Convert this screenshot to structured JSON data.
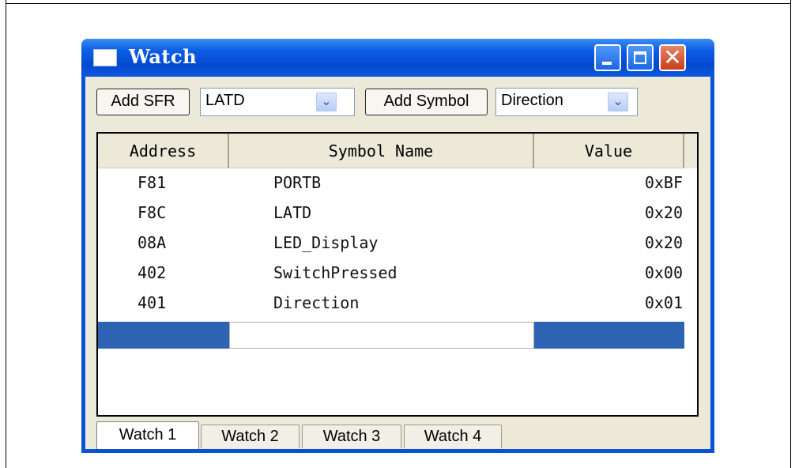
{
  "window": {
    "title": "Watch",
    "controls": {
      "minimize": "minimize-icon",
      "maximize": "maximize-icon",
      "close": "close-icon",
      "close_glyph": "✕"
    }
  },
  "toolbar": {
    "add_sfr_label": "Add SFR",
    "sfr_selected": "LATD",
    "add_symbol_label": "Add Symbol",
    "symbol_selected": "Direction",
    "dropdown_glyph": "⌄"
  },
  "grid": {
    "columns": [
      "Address",
      "Symbol Name",
      "Value"
    ],
    "rows": [
      {
        "address": "F81",
        "symbol": "PORTB",
        "value": "0xBF"
      },
      {
        "address": "F8C",
        "symbol": "LATD",
        "value": "0x20"
      },
      {
        "address": "08A",
        "symbol": "LED_Display",
        "value": "0x20"
      },
      {
        "address": "402",
        "symbol": "SwitchPressed",
        "value": "0x00"
      },
      {
        "address": "401",
        "symbol": "Direction",
        "value": "0x01"
      }
    ]
  },
  "tabs": [
    "Watch 1",
    "Watch 2",
    "Watch 3",
    "Watch 4"
  ],
  "active_tab": "Watch 1",
  "colors": {
    "title_bar": "#0a52d4",
    "selection": "#2e63b4",
    "client_bg": "#ece9d8"
  }
}
